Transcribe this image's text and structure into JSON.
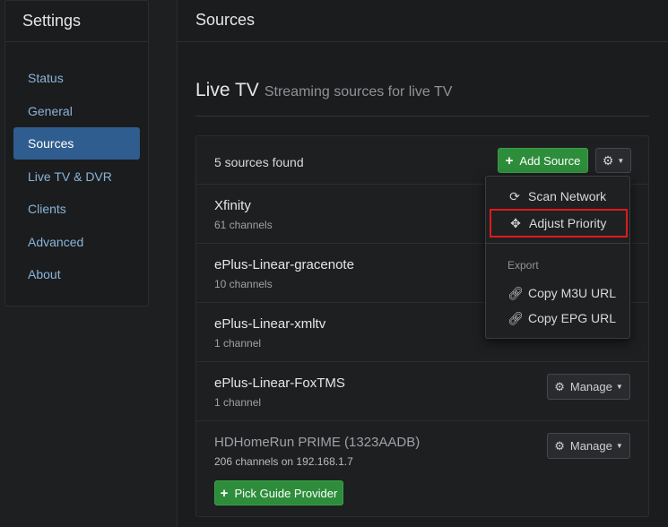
{
  "sidebar": {
    "title": "Settings",
    "items": [
      {
        "label": "Status",
        "active": false
      },
      {
        "label": "General",
        "active": false
      },
      {
        "label": "Sources",
        "active": true
      },
      {
        "label": "Live TV & DVR",
        "active": false
      },
      {
        "label": "Clients",
        "active": false
      },
      {
        "label": "Advanced",
        "active": false
      },
      {
        "label": "About",
        "active": false
      }
    ]
  },
  "main": {
    "header_title": "Sources",
    "page_title": "Live TV",
    "page_subtitle": "Streaming sources for live TV",
    "count_text": "5 sources found",
    "add_source_label": "Add Source",
    "sources": [
      {
        "name": "Xfinity",
        "detail": "61 channels"
      },
      {
        "name": "ePlus-Linear-gracenote",
        "detail": "10 channels"
      },
      {
        "name": "ePlus-Linear-xmltv",
        "detail": "1 channel"
      },
      {
        "name": "ePlus-Linear-FoxTMS",
        "detail": "1 channel",
        "manage_label": "Manage"
      },
      {
        "name": "HDHomeRun PRIME (1323AADB)",
        "detail": "206 channels on 192.168.1.7",
        "manage_label": "Manage",
        "extra_button": "Pick Guide Provider"
      }
    ]
  },
  "dropdown": {
    "scan_network": "Scan Network",
    "adjust_priority": "Adjust Priority",
    "export_header": "Export",
    "copy_m3u": "Copy M3U URL",
    "copy_epg": "Copy EPG URL"
  },
  "colors": {
    "accent_blue": "#2f5d8f",
    "green": "#2d8d3b",
    "highlight_red": "#e01a1a"
  }
}
